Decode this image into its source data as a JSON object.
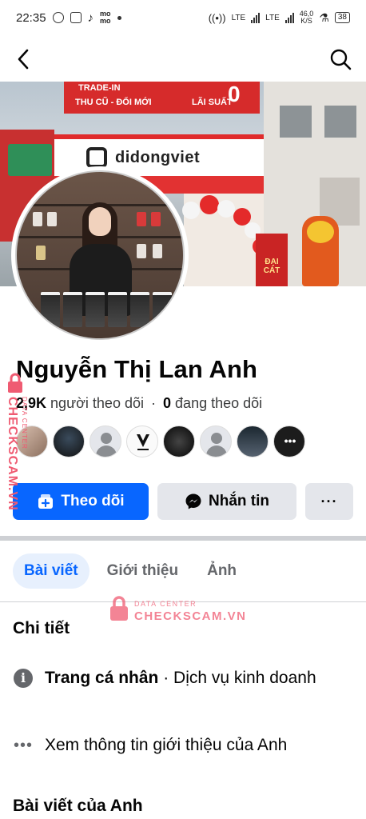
{
  "status_bar": {
    "time": "22:35",
    "network_1": "LTE",
    "network_2": "LTE",
    "speed_value": "46,0",
    "speed_unit": "K/S",
    "battery": "38"
  },
  "app_bar": {
    "back_icon": "arrow-left-icon",
    "search_icon": "search-icon"
  },
  "cover": {
    "sign_line1": "TRADE-IN",
    "sign_line2": "THU CŨ - ĐỔI MỚI",
    "sign_line3": "LÃI SUẤT",
    "sign_big": "0",
    "brand": "didongviet",
    "banner": [
      "ĐẠI",
      "CÁT"
    ]
  },
  "profile": {
    "name": "Nguyễn Thị Lan Anh",
    "followers_count": "2,9K",
    "followers_label": "người theo dõi",
    "separator": "·",
    "following_count": "0",
    "following_label": "đang theo dõi"
  },
  "actions": {
    "follow_label": "Theo dõi",
    "message_label": "Nhắn tin",
    "more_label": "···"
  },
  "tabs": [
    {
      "label": "Bài viết",
      "active": true
    },
    {
      "label": "Giới thiệu",
      "active": false
    },
    {
      "label": "Ảnh",
      "active": false
    }
  ],
  "details": {
    "title": "Chi tiết",
    "page_type_bold": "Trang cá nhân",
    "page_type_rest": " · Dịch vụ kinh doanh",
    "see_more": "Xem thông tin giới thiệu của Anh"
  },
  "posts": {
    "title": "Bài viết của Anh"
  },
  "watermark": {
    "side_big": "CHECKSCAM.VN",
    "side_small": "DATA CENTER",
    "center_small": "DATA CENTER",
    "center_big": "CHECKSCAM.VN"
  },
  "colors": {
    "primary": "#0866ff",
    "watermark": "#ef5b72",
    "secondary_button": "#e4e6eb"
  }
}
